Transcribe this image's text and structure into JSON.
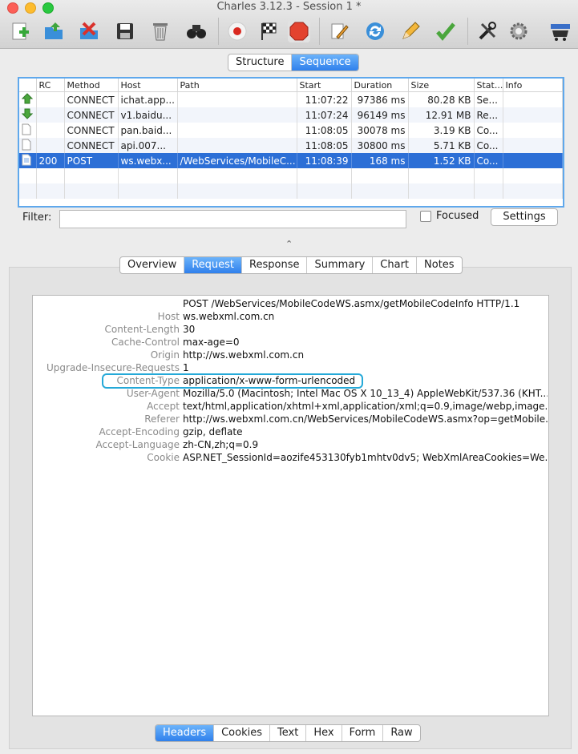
{
  "window": {
    "title": "Charles 3.12.3 - Session 1 *"
  },
  "toolbar": {
    "icons": [
      "new-session-icon",
      "open-session-icon",
      "close-session-icon",
      "save-icon",
      "trash-icon",
      "find-icon",
      "record-icon",
      "throttle-flag-icon",
      "stop-breakpoints-icon",
      "compose-icon",
      "repeat-icon",
      "edit-icon",
      "validate-icon",
      "tools-icon",
      "settings-gear-icon",
      "shop-cart-icon"
    ]
  },
  "view_tabs": {
    "structure": "Structure",
    "sequence": "Sequence"
  },
  "columns": [
    "RC",
    "Method",
    "Host",
    "Path",
    "Start",
    "Duration",
    "Size",
    "Stat...",
    "Info"
  ],
  "rows": [
    {
      "icon": "upload-arrow-icon",
      "rc": "",
      "method": "CONNECT",
      "host": "ichat.app...",
      "path": "",
      "start": "11:07:22",
      "duration": "97386 ms",
      "size": "80.28 KB",
      "status": "Se...",
      "info": ""
    },
    {
      "icon": "download-arrow-icon",
      "rc": "",
      "method": "CONNECT",
      "host": "v1.baidu...",
      "path": "",
      "start": "11:07:24",
      "duration": "96149 ms",
      "size": "12.91 MB",
      "status": "Re...",
      "info": ""
    },
    {
      "icon": "document-icon",
      "rc": "",
      "method": "CONNECT",
      "host": "pan.baid...",
      "path": "",
      "start": "11:08:05",
      "duration": "30078 ms",
      "size": "3.19 KB",
      "status": "Co...",
      "info": ""
    },
    {
      "icon": "document-icon",
      "rc": "",
      "method": "CONNECT",
      "host": "api.007...",
      "path": "",
      "start": "11:08:05",
      "duration": "30800 ms",
      "size": "5.71 KB",
      "status": "Co...",
      "info": ""
    },
    {
      "icon": "document-text-icon",
      "rc": "200",
      "method": "POST",
      "host": "ws.webx...",
      "path": "/WebServices/MobileC...",
      "start": "11:08:39",
      "duration": "168 ms",
      "size": "1.52 KB",
      "status": "Co...",
      "info": ""
    }
  ],
  "filter": {
    "label": "Filter:",
    "value": "",
    "focused_label": "Focused",
    "settings_label": "Settings"
  },
  "detail_tabs": [
    "Overview",
    "Request",
    "Response",
    "Summary",
    "Chart",
    "Notes"
  ],
  "request_headers": [
    {
      "key": "",
      "value": "POST /WebServices/MobileCodeWS.asmx/getMobileCodeInfo HTTP/1.1"
    },
    {
      "key": "Host",
      "value": "ws.webxml.com.cn"
    },
    {
      "key": "Content-Length",
      "value": "30"
    },
    {
      "key": "Cache-Control",
      "value": "max-age=0"
    },
    {
      "key": "Origin",
      "value": "http://ws.webxml.com.cn"
    },
    {
      "key": "Upgrade-Insecure-Requests",
      "value": "1"
    },
    {
      "key": "Content-Type",
      "value": "application/x-www-form-urlencoded"
    },
    {
      "key": "User-Agent",
      "value": "Mozilla/5.0 (Macintosh; Intel Mac OS X 10_13_4) AppleWebKit/537.36 (KHT..."
    },
    {
      "key": "Accept",
      "value": "text/html,application/xhtml+xml,application/xml;q=0.9,image/webp,image..."
    },
    {
      "key": "Referer",
      "value": "http://ws.webxml.com.cn/WebServices/MobileCodeWS.asmx?op=getMobile..."
    },
    {
      "key": "Accept-Encoding",
      "value": "gzip, deflate"
    },
    {
      "key": "Accept-Language",
      "value": "zh-CN,zh;q=0.9"
    },
    {
      "key": "Cookie",
      "value": "ASP.NET_SessionId=aozife453130fyb1mhtv0dv5; WebXmlAreaCookies=We..."
    }
  ],
  "bottom_tabs": [
    "Headers",
    "Cookies",
    "Text",
    "Hex",
    "Form",
    "Raw"
  ],
  "colors": {
    "accent": "#2f80ec",
    "selection": "#2c6fd6",
    "highlight": "#25a9d8"
  }
}
